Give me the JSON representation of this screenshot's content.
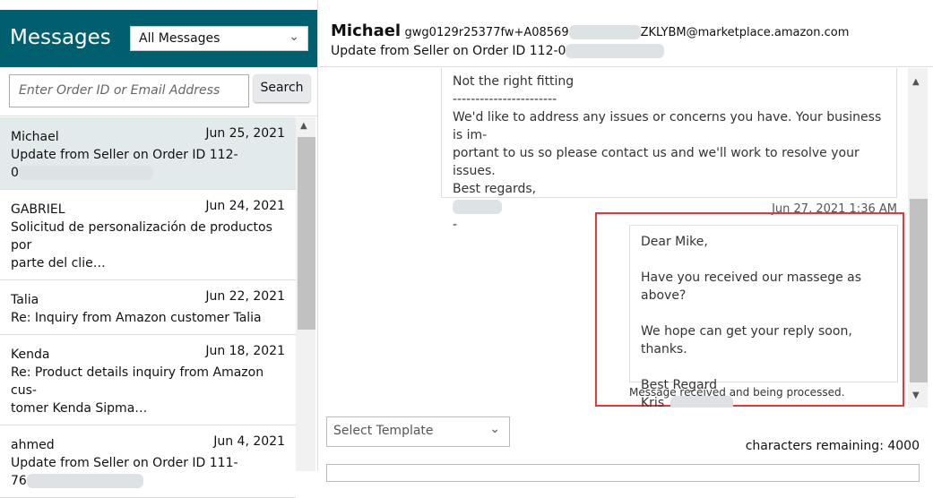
{
  "sidebar": {
    "title": "Messages",
    "filter": "All Messages",
    "search_placeholder": "Enter Order ID or Email Address",
    "search_button": "Search",
    "items": [
      {
        "name": "Michael",
        "date": "Jun 25, 2021",
        "subject": "Update from Seller on Order ID 112-",
        "subject2": "0"
      },
      {
        "name": "GABRIEL",
        "date": "Jun 24, 2021",
        "subject": "Solicitud de personalización de productos por",
        "subject2": "parte del clie…"
      },
      {
        "name": "Talia",
        "date": "Jun 22, 2021",
        "subject": "Re: Inquiry from Amazon customer Talia",
        "subject2": ""
      },
      {
        "name": "Kenda",
        "date": "Jun 18, 2021",
        "subject": "Re: Product details inquiry from Amazon cus-",
        "subject2": "tomer Kenda Sipma…"
      },
      {
        "name": "ahmed",
        "date": "Jun 4, 2021",
        "subject": "Update from Seller on Order ID 111-",
        "subject2": "76"
      }
    ]
  },
  "conversation": {
    "name": "Michael",
    "email_start": "gwg0129r25377fw+A08569",
    "email_end": "ZKLYBM@marketplace.amazon.com",
    "subject": "Update from Seller on Order ID 112-0",
    "message1": [
      "Not the right fitting",
      "-----------------------",
      "We'd like to address any issues or concerns you have. Your business is im-",
      "portant to us so please contact us and we'll work to resolve your issues.",
      "Best regards,",
      "",
      "-"
    ],
    "timestamp": "Jun 27, 2021 1:36 AM",
    "message2": [
      "Dear Mike,",
      "",
      "Have you received our massege as above?",
      "",
      "We hope can get your reply soon, thanks.",
      "",
      "Best Regard",
      "Kris_"
    ],
    "status": "Message received and being processed."
  },
  "compose": {
    "template": "Select Template",
    "chars_remaining": "characters remaining: 4000"
  },
  "colors": {
    "header": "#005f6f",
    "highlight": "#e03a3e"
  }
}
